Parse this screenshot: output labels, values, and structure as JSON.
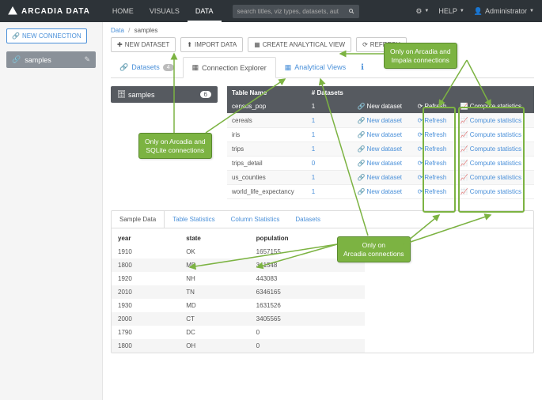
{
  "brand": "ARCADIA DATA",
  "nav": {
    "home": "HOME",
    "visuals": "VISUALS",
    "data": "DATA"
  },
  "search": {
    "placeholder": "search titles, viz types, datasets, authors..."
  },
  "topright": {
    "help": "HELP",
    "user": "Administrator"
  },
  "sidebar": {
    "new_connection": "NEW CONNECTION",
    "item": "samples"
  },
  "breadcrumb": {
    "root": "Data",
    "current": "samples"
  },
  "toolbar": {
    "new_dataset": "NEW DATASET",
    "import": "IMPORT DATA",
    "create_view": "CREATE ANALYTICAL VIEW",
    "refresh": "REFRESH"
  },
  "tabs": {
    "datasets": "Datasets",
    "datasets_count": "4",
    "explorer": "Connection Explorer",
    "views": "Analytical Views"
  },
  "left_panel": {
    "title": "samples",
    "count": "6"
  },
  "table": {
    "h1": "Table Name",
    "h2": "# Datasets",
    "actions": {
      "new": "New dataset",
      "refresh": "Refresh",
      "compute": "Compute statistics"
    },
    "rows": [
      {
        "name": "census_pop",
        "count": "1"
      },
      {
        "name": "cereals",
        "count": "1"
      },
      {
        "name": "iris",
        "count": "1"
      },
      {
        "name": "trips",
        "count": "1"
      },
      {
        "name": "trips_detail",
        "count": "0"
      },
      {
        "name": "us_counties",
        "count": "1"
      },
      {
        "name": "world_life_expectancy",
        "count": "1"
      }
    ]
  },
  "subtabs": {
    "sample": "Sample Data",
    "table_stats": "Table Statistics",
    "col_stats": "Column Statistics",
    "datasets": "Datasets"
  },
  "sample": {
    "h1": "year",
    "h2": "state",
    "h3": "population",
    "rows": [
      {
        "y": "1910",
        "s": "OK",
        "p": "1657155"
      },
      {
        "y": "1800",
        "s": "MD",
        "p": "341548"
      },
      {
        "y": "1920",
        "s": "NH",
        "p": "443083"
      },
      {
        "y": "2010",
        "s": "TN",
        "p": "6346165"
      },
      {
        "y": "1930",
        "s": "MD",
        "p": "1631526"
      },
      {
        "y": "2000",
        "s": "CT",
        "p": "3405565"
      },
      {
        "y": "1790",
        "s": "DC",
        "p": "0"
      },
      {
        "y": "1800",
        "s": "OH",
        "p": "0"
      }
    ]
  },
  "anno": {
    "a1": "Only on Arcadia and\nSQLite connections",
    "a2": "Only on Arcadia and\nImpala connections",
    "a3": "Only on\nArcadia connections"
  }
}
